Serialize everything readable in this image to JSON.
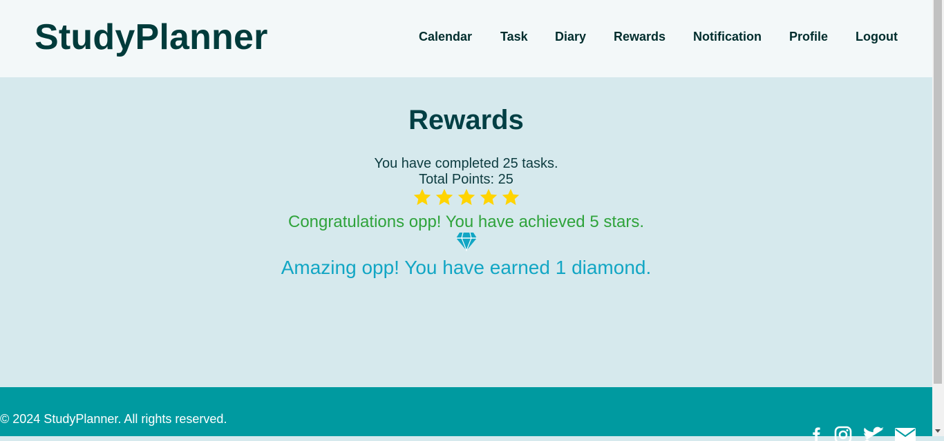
{
  "app": {
    "logo": "StudyPlanner"
  },
  "nav": {
    "items": [
      {
        "label": "Calendar"
      },
      {
        "label": "Task"
      },
      {
        "label": "Diary"
      },
      {
        "label": "Rewards"
      },
      {
        "label": "Notification"
      },
      {
        "label": "Profile"
      },
      {
        "label": "Logout"
      }
    ]
  },
  "rewards": {
    "title": "Rewards",
    "completed_text": "You have completed 25 tasks.",
    "points_text": "Total Points: 25",
    "stars_earned": 5,
    "star_color": "#ffd400",
    "congrats_text": "Congratulations opp! You have achieved 5 stars.",
    "congrats_color": "#2fa33b",
    "diamond_color": "#12a6c4",
    "diamond_text": "Amazing opp! You have earned 1 diamond."
  },
  "footer": {
    "copyright": "© 2024 StudyPlanner. All rights reserved.",
    "social_icons": [
      "facebook-icon",
      "instagram-icon",
      "twitter-icon",
      "email-icon"
    ]
  }
}
